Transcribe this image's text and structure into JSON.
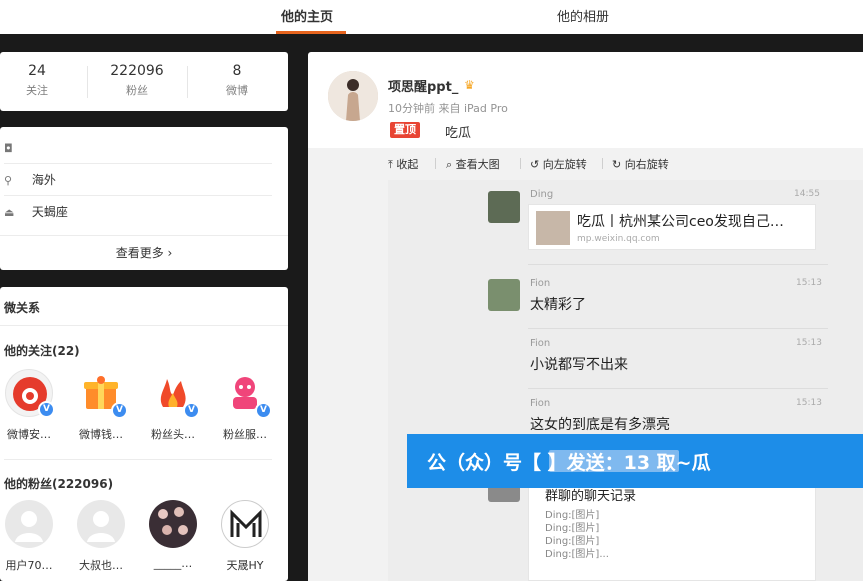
{
  "nav": {
    "tabs": [
      {
        "label": "他的主页"
      },
      {
        "label": "他的相册"
      }
    ]
  },
  "counts": [
    {
      "num": "24",
      "label": "关注"
    },
    {
      "num": "222096",
      "label": "粉丝"
    },
    {
      "num": "8",
      "label": "微博"
    }
  ],
  "info": {
    "rows": [
      {
        "text": ""
      },
      {
        "text": "海外"
      },
      {
        "text": "天蝎座"
      }
    ],
    "more": "查看更多 ›"
  },
  "relations": {
    "title": "微关系",
    "following_title": "他的关注(22)",
    "following": [
      {
        "name": "微博安…"
      },
      {
        "name": "微博钱…"
      },
      {
        "name": "粉丝头…"
      },
      {
        "name": "粉丝服…"
      }
    ],
    "fans_title": "他的粉丝(222096)",
    "fans": [
      {
        "name": "用户70…"
      },
      {
        "name": "大叔也…"
      },
      {
        "name": "_____…"
      },
      {
        "name": "天晟HY"
      }
    ]
  },
  "post": {
    "author": "项思醒ppt_",
    "meta": "10分钟前 来自 iPad Pro",
    "tag": "置顶",
    "text": "吃瓜"
  },
  "toolbar": [
    {
      "label": "⤒ 收起"
    },
    {
      "label": "⌕ 查看大图"
    },
    {
      "label": "↺ 向左旋转"
    },
    {
      "label": "↻ 向右旋转"
    }
  ],
  "chat": {
    "messages": [
      {
        "name": "Ding",
        "time": "14:55",
        "text": ""
      },
      {
        "name": "Fion",
        "time": "15:13",
        "text": "太精彩了"
      },
      {
        "name": "Fion",
        "time": "15:13",
        "text": "小说都写不出来"
      },
      {
        "name": "Fion",
        "time": "15:13",
        "text": "这女的到底是有多漂亮"
      }
    ],
    "link": {
      "title": "吃瓜丨杭州某公司ceo发现自己…",
      "url": "mp.weixin.qq.com"
    },
    "record": {
      "title": "群聊的聊天记录",
      "lines": [
        "Ding:[图片]",
        "Ding:[图片]",
        "Ding:[图片]",
        "Ding:[图片]..."
      ]
    }
  },
  "banner": {
    "text": "公（众）号【                   】发送：13  取~瓜"
  },
  "colors": {
    "accent": "#e6641e",
    "banner": "#1d8de8",
    "vip": "#3c8cf0",
    "top_tag": "#e84433"
  }
}
